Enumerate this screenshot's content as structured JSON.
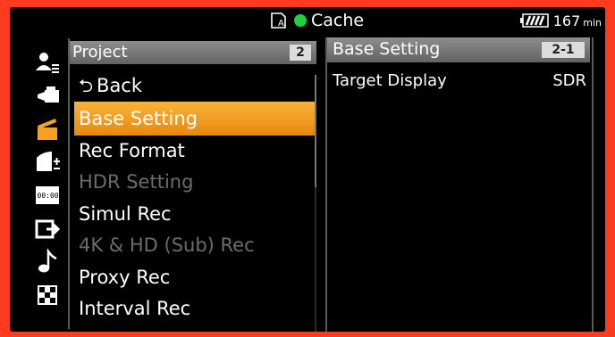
{
  "status": {
    "media_label": "Cache",
    "battery_time": "167",
    "battery_unit": "min",
    "rec_dot_color": "#1fd13a"
  },
  "sidebar": {
    "icons": [
      "user-menu-icon",
      "camera-settings-icon",
      "project-clapper-icon",
      "paint-look-icon",
      "timecode-icon",
      "output-icon",
      "audio-note-icon",
      "checker-maintenance-icon"
    ],
    "active_index": 2,
    "active_color": "#f6a21e"
  },
  "menu": {
    "header": "Project",
    "page": "2",
    "items": [
      {
        "label": "Back",
        "state": "normal"
      },
      {
        "label": "Base Setting",
        "state": "selected"
      },
      {
        "label": "Rec Format",
        "state": "normal"
      },
      {
        "label": "HDR Setting",
        "state": "disabled"
      },
      {
        "label": "Simul Rec",
        "state": "normal"
      },
      {
        "label": "4K & HD (Sub) Rec",
        "state": "disabled"
      },
      {
        "label": "Proxy Rec",
        "state": "normal"
      },
      {
        "label": "Interval Rec",
        "state": "normal"
      }
    ]
  },
  "detail": {
    "header": "Base Setting",
    "page": "2-1",
    "row_label": "Target Display",
    "row_value": "SDR"
  }
}
